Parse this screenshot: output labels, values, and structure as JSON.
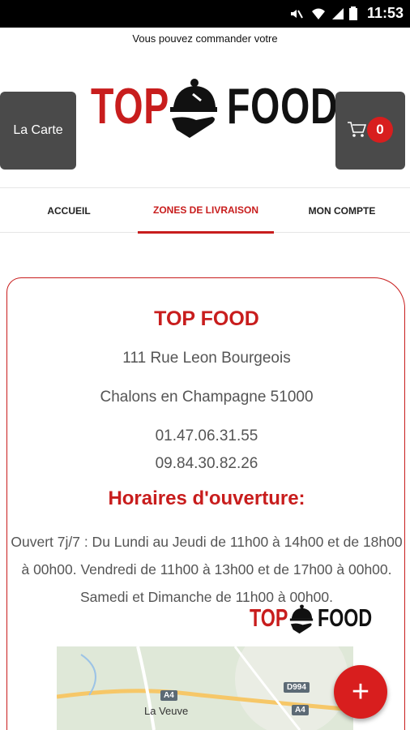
{
  "status_bar": {
    "time": "11:53",
    "icons": [
      "mute-icon",
      "wifi-icon",
      "signal-icon",
      "battery-icon"
    ]
  },
  "banner": {
    "text": "Vous pouvez commander votre"
  },
  "header": {
    "carte_button": "La Carte",
    "logo_top": "TOP",
    "logo_food": "FOOD",
    "cart_count": "0"
  },
  "nav": {
    "tabs": [
      {
        "label": "ACCUEIL",
        "active": false
      },
      {
        "label": "ZONES DE LIVRAISON",
        "active": true
      },
      {
        "label": "MON COMPTE",
        "active": false
      }
    ]
  },
  "restaurant": {
    "name": "TOP FOOD",
    "street": "111 Rue Leon Bourgeois",
    "city": "Chalons en Champagne 51000",
    "phone1": "01.47.06.31.55",
    "phone2": "09.84.30.82.26",
    "hours_title": "Horaires d'ouverture:",
    "hours_text": "Ouvert 7j/7 : Du Lundi au Jeudi de 11h00 à 14h00 et de 18h00 à 00h00. Vendredi de 11h00 à 13h00 et de 17h00 à 00h00. Samedi et Dimanche de 11h00 à 00h00."
  },
  "watermark": {
    "top": "TOP",
    "food": "FOOD"
  },
  "map": {
    "place": "La Veuve",
    "roads": [
      "A4",
      "D994",
      "A4"
    ]
  },
  "fab": {
    "label": "+"
  },
  "colors": {
    "brand_red": "#c81d1d",
    "dark_button": "#4a4a4a",
    "badge_red": "#d81e1e"
  }
}
